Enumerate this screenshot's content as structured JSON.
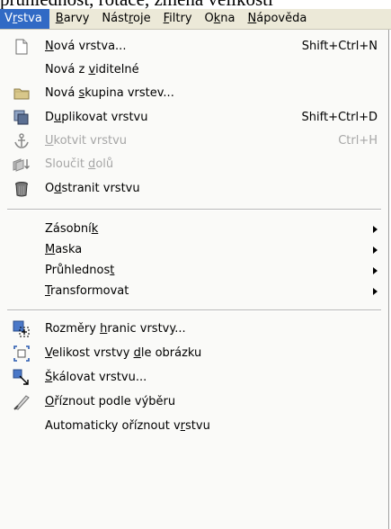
{
  "background_text": "průhlednost, rotace, změna velikosti",
  "menubar": {
    "items": [
      {
        "pre": "V",
        "u": "r",
        "post": "stva"
      },
      {
        "pre": "",
        "u": "B",
        "post": "arvy"
      },
      {
        "pre": "Nást",
        "u": "r",
        "post": "oje"
      },
      {
        "pre": "",
        "u": "F",
        "post": "iltry"
      },
      {
        "pre": "O",
        "u": "k",
        "post": "na"
      },
      {
        "pre": "",
        "u": "N",
        "post": "ápověda"
      }
    ]
  },
  "menu": {
    "items": [
      {
        "pre": "",
        "u": "N",
        "post": "ová vrstva...",
        "shortcut": "Shift+Ctrl+N",
        "icon": "new-layer-icon"
      },
      {
        "pre": "Nová z ",
        "u": "v",
        "post": "iditelné",
        "shortcut": "",
        "icon": ""
      },
      {
        "pre": "Nová ",
        "u": "s",
        "post": "kupina vrstev...",
        "shortcut": "",
        "icon": "folder-icon"
      },
      {
        "pre": "D",
        "u": "u",
        "post": "plikovat vrstvu",
        "shortcut": "Shift+Ctrl+D",
        "icon": "duplicate-icon"
      },
      {
        "pre": "",
        "u": "U",
        "post": "kotvit vrstvu",
        "shortcut": "Ctrl+H",
        "icon": "anchor-icon",
        "disabled": true
      },
      {
        "pre": "Sloučit ",
        "u": "d",
        "post": "olů",
        "shortcut": "",
        "icon": "merge-down-icon",
        "disabled": true
      },
      {
        "pre": "O",
        "u": "d",
        "post": "stranit vrstvu",
        "shortcut": "",
        "icon": "trash-icon"
      },
      {
        "pre": "Zásobní",
        "u": "k",
        "post": "",
        "submenu": true
      },
      {
        "pre": "",
        "u": "M",
        "post": "aska",
        "submenu": true
      },
      {
        "pre": "Průhlednos",
        "u": "t",
        "post": "",
        "submenu": true
      },
      {
        "pre": "",
        "u": "T",
        "post": "ransformovat",
        "submenu": true
      },
      {
        "pre": "Rozměry ",
        "u": "h",
        "post": "ranic vrstvy...",
        "icon": "layer-boundary-icon"
      },
      {
        "pre": "",
        "u": "V",
        "post": "elikost vrstvy ",
        "u2": "d",
        "post2": "le obrázku",
        "icon": "layer-to-image-size-icon"
      },
      {
        "pre": "",
        "u": "Š",
        "post": "kálovat vrstvu...",
        "icon": "scale-layer-icon"
      },
      {
        "pre": "",
        "u": "O",
        "post": "říznout podle výběru",
        "icon": "crop-icon"
      },
      {
        "pre": "Automaticky oříznout v",
        "u": "r",
        "post": "stvu",
        "icon": ""
      }
    ]
  },
  "colors": {
    "highlight": "#316ac5",
    "menubar_bg": "#ece9d8",
    "disabled_text": "#a6a6a6"
  }
}
